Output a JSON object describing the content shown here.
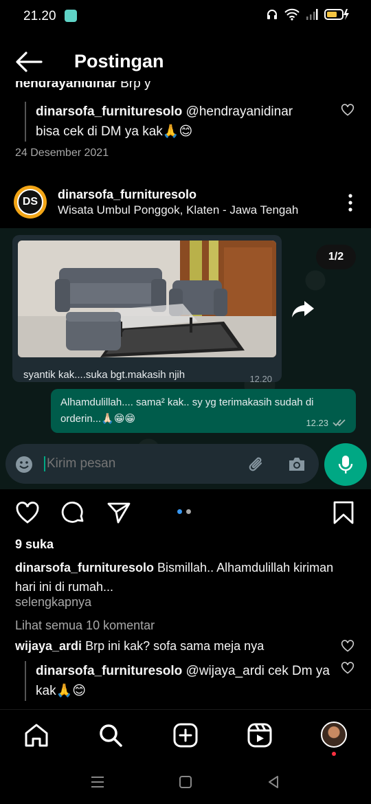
{
  "status_bar": {
    "time": "21.20"
  },
  "header": {
    "title": "Postingan"
  },
  "previous_post": {
    "cut_comment_user": "hendrayanidinar",
    "cut_comment_text": "Brp y",
    "reply": {
      "username": "dinarsofa_furnituresolo",
      "mention": "@hendrayanidinar",
      "text": "bisa cek di DM ya kak🙏😊"
    },
    "date": "24 Desember 2021"
  },
  "post": {
    "avatar_text": "DS",
    "username": "dinarsofa_furnituresolo",
    "location": "Wisata Umbul Ponggok, Klaten - Jawa Tengah",
    "image_counter": "1/2",
    "chat": {
      "incoming_caption": "syantik kak....suka bgt.makasih njih",
      "incoming_time": "12.20",
      "outgoing_text": "Alhamdulillah.... sama² kak.. sy yg terimakasih sudah di orderin...🙏🏻😁😁",
      "outgoing_time": "12.23",
      "compose_placeholder": "Kirim pesan"
    },
    "likes": "9 suka",
    "caption_user": "dinarsofa_furnituresolo",
    "caption_text": "Bismillah.. Alhamdulillah kiriman hari ini di rumah...",
    "more_label": "selengkapnya",
    "view_comments": "Lihat semua 10 komentar",
    "comments": [
      {
        "username": "wijaya_ardi",
        "text": "Brp ini kak? sofa sama meja nya"
      }
    ],
    "reply": {
      "username": "dinarsofa_furnituresolo",
      "mention": "@wijaya_ardi",
      "text": "cek Dm ya kak🙏😊"
    }
  },
  "colors": {
    "background": "#000000",
    "wa_green": "#00a884",
    "wa_bubble_out": "#005c4b",
    "wa_bubble_in": "#1f2c33",
    "carousel_active": "#3897f0"
  },
  "icons": {
    "bottom_nav": [
      "home-icon",
      "search-icon",
      "create-icon",
      "reels-icon",
      "profile-icon"
    ],
    "actions": [
      "heart-icon",
      "comment-icon",
      "share-icon",
      "bookmark-icon"
    ]
  }
}
